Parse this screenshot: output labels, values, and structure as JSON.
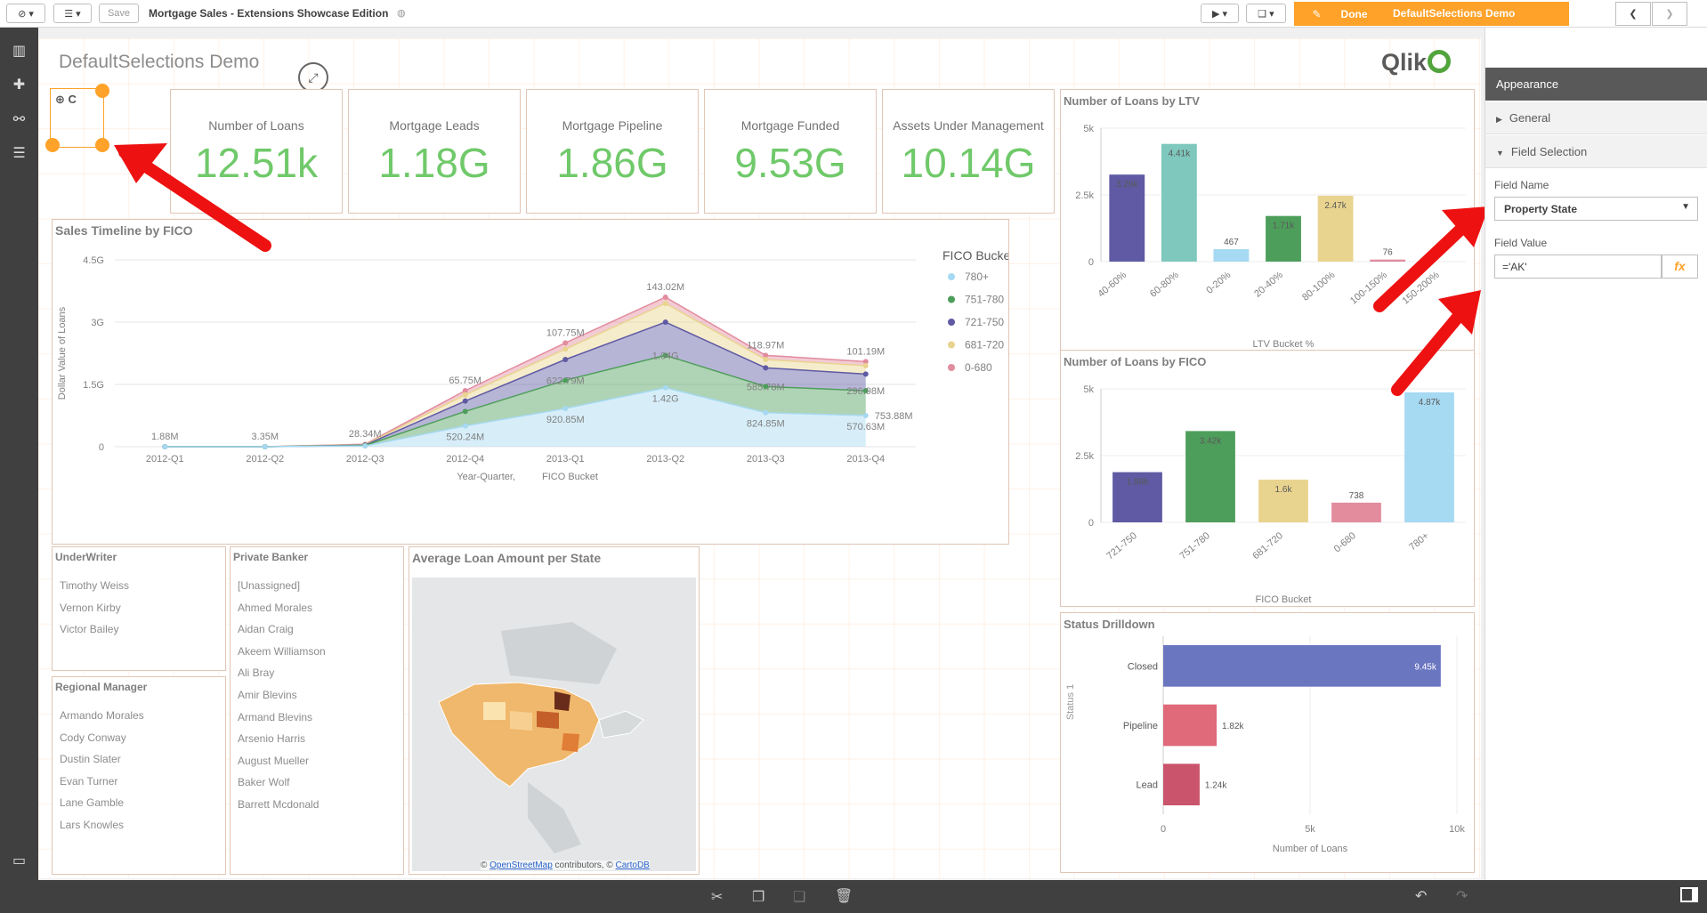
{
  "topbar": {
    "save": "Save",
    "app_title": "Mortgage Sales - Extensions Showcase Edition",
    "done": "Done",
    "sheet": "DefaultSelections Demo"
  },
  "sheet": {
    "title": "DefaultSelections Demo",
    "logo": "Qlik",
    "ext_label": "C"
  },
  "kpis": [
    {
      "label": "Number of Loans",
      "value": "12.51k"
    },
    {
      "label": "Mortgage Leads",
      "value": "1.18G"
    },
    {
      "label": "Mortgage Pipeline",
      "value": "1.86G"
    },
    {
      "label": "Mortgage Funded",
      "value": "9.53G"
    },
    {
      "label": "Assets Under Management",
      "value": "10.14G"
    }
  ],
  "timeline": {
    "title": "Sales Timeline by FICO",
    "ylabel": "Dollar Value of Loans",
    "xlabel": "Year-Quarter,",
    "xlabel2": "FICO Bucket",
    "legend_title": "FICO Bucket",
    "yticks": [
      "4.5G",
      "3G",
      "1.5G",
      "0"
    ],
    "quarters": [
      "2012-Q1",
      "2012-Q2",
      "2012-Q3",
      "2012-Q4",
      "2013-Q1",
      "2013-Q2",
      "2013-Q3",
      "2013-Q4"
    ],
    "top_labels": [
      "1.88M",
      "3.35M",
      "28.34M",
      "65.75M",
      "107.75M",
      "143.02M",
      "118.97M",
      "101.19M"
    ],
    "mid_labels": [
      "",
      "",
      "",
      "",
      "622.79M",
      "1.04G",
      "585.78M",
      "296.98M"
    ],
    "low_labels": [
      "",
      "",
      "",
      "520.24M",
      "920.85M",
      "1.42G",
      "824.85M",
      "570.63M"
    ],
    "base_label": "753.88M",
    "series": [
      {
        "name": "780+",
        "color": "#a6d9f2"
      },
      {
        "name": "751-780",
        "color": "#4e9e5b"
      },
      {
        "name": "721-750",
        "color": "#5f5aa3"
      },
      {
        "name": "681-720",
        "color": "#e9d48f"
      },
      {
        "name": "0-680",
        "color": "#e28c9e"
      }
    ]
  },
  "underwriter": {
    "title": "UnderWriter",
    "items": [
      "Timothy Weiss",
      "Vernon Kirby",
      "Victor Bailey"
    ]
  },
  "regional": {
    "title": "Regional Manager",
    "items": [
      "Armando Morales",
      "Cody Conway",
      "Dustin Slater",
      "Evan Turner",
      "Lane Gamble",
      "Lars Knowles"
    ]
  },
  "banker": {
    "title": "Private Banker",
    "items": [
      "[Unassigned]",
      "Ahmed Morales",
      "Aidan Craig",
      "Akeem Williamson",
      "Ali Bray",
      "Amir Blevins",
      "Armand Blevins",
      "Arsenio Harris",
      "August Mueller",
      "Baker Wolf",
      "Barrett Mcdonald"
    ]
  },
  "map": {
    "title": "Average Loan Amount per State",
    "credit1": "© ",
    "osm": "OpenStreetMap",
    "credit2": " contributors, © ",
    "carto": "CartoDB"
  },
  "chart_data": [
    {
      "type": "bar",
      "title": "Number of Loans by LTV",
      "xlabel": "LTV Bucket %",
      "yticks": [
        "5k",
        "2.5k",
        "0"
      ],
      "ylim": [
        0,
        5000
      ],
      "categories": [
        "40-60%",
        "60-80%",
        "0-20%",
        "20-40%",
        "80-100%",
        "100-150%",
        "150-200%"
      ],
      "values": [
        3260,
        4410,
        467,
        1710,
        2470,
        76,
        0
      ],
      "labels": [
        "3.26k",
        "4.41k",
        "467",
        "1.71k",
        "2.47k",
        "76",
        ""
      ],
      "colors": [
        "#5f5aa3",
        "#7ec8bd",
        "#a6d9f2",
        "#4e9e5b",
        "#e9d48f",
        "#e28c9e",
        "#e28c9e"
      ]
    },
    {
      "type": "bar",
      "title": "Number of Loans by FICO",
      "xlabel": "FICO Bucket",
      "yticks": [
        "5k",
        "2.5k",
        "0"
      ],
      "ylim": [
        0,
        5000
      ],
      "categories": [
        "721-750",
        "751-780",
        "681-720",
        "0-680",
        "780+"
      ],
      "values": [
        1880,
        3420,
        1600,
        738,
        4870
      ],
      "labels": [
        "1.88k",
        "3.42k",
        "1.6k",
        "738",
        "4.87k"
      ],
      "colors": [
        "#5f5aa3",
        "#4e9e5b",
        "#e9d48f",
        "#e28c9e",
        "#a6d9f2"
      ]
    },
    {
      "type": "bar",
      "orientation": "horizontal",
      "title": "Status Drilldown",
      "xlabel": "Number of Loans",
      "ylabel": "Status 1",
      "xticks": [
        "0",
        "5k",
        "10k"
      ],
      "xlim": [
        0,
        10000
      ],
      "categories": [
        "Closed",
        "Pipeline",
        "Lead"
      ],
      "values": [
        9450,
        1820,
        1240
      ],
      "labels": [
        "9.45k",
        "1.82k",
        "1.24k"
      ],
      "colors": [
        "#6b76c1",
        "#e0697a",
        "#c9546b"
      ]
    }
  ],
  "props": {
    "header": "Appearance",
    "general": "General",
    "field_selection": "Field Selection",
    "field_name_label": "Field Name",
    "field_name_value": "Property State",
    "field_value_label": "Field Value",
    "field_value": "='AK'",
    "fx": "fx"
  }
}
